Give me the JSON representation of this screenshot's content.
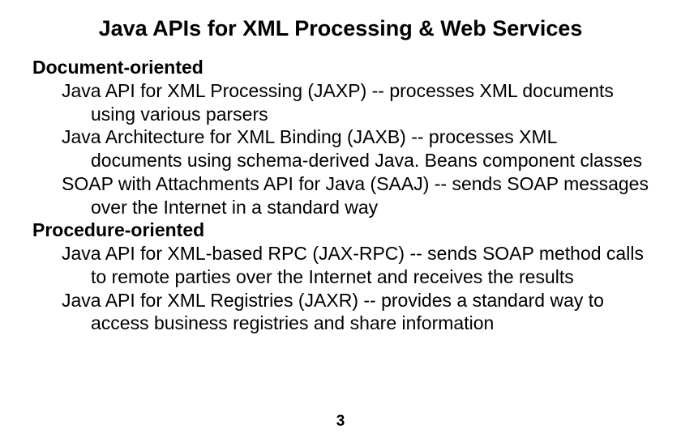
{
  "title": "Java APIs for XML Processing & Web Services",
  "section1": {
    "heading": "Document-oriented",
    "items": [
      "Java API for XML Processing (JAXP) -- processes XML documents using various parsers",
      "Java Architecture for XML Binding (JAXB) -- processes XML documents using schema-derived Java. Beans  component classes",
      "SOAP with Attachments API for Java (SAAJ) -- sends SOAP messages over the Internet in a standard way"
    ]
  },
  "section2": {
    "heading": "Procedure-oriented",
    "items": [
      "Java API for XML-based RPC (JAX-RPC) -- sends SOAP method calls to remote parties over the Internet and receives the results",
      "Java API for XML Registries (JAXR) -- provides a standard way to access business registries and share information"
    ]
  },
  "page_number": "3"
}
